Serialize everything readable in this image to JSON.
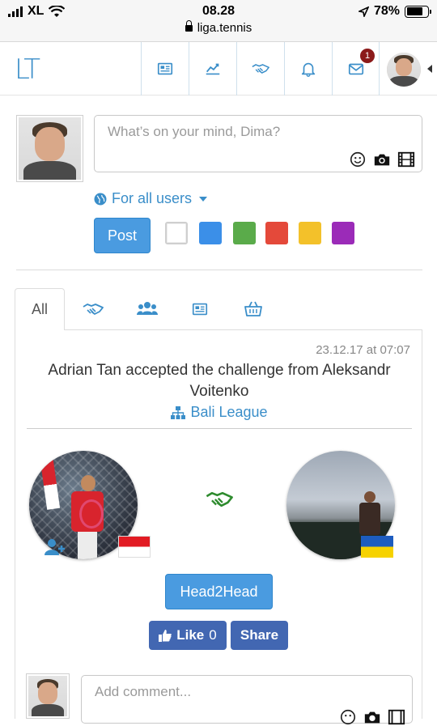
{
  "status_bar": {
    "carrier": "XL",
    "time": "08.28",
    "url": "liga.tennis",
    "battery": "78%",
    "battery_level": 0.78
  },
  "navbar": {
    "logo": "LT",
    "notification_count": "1",
    "icons": [
      "newspaper-icon",
      "chart-line-icon",
      "handshake-icon",
      "bell-icon",
      "envelope-icon"
    ]
  },
  "composer": {
    "placeholder": "What’s on your mind, Dima?",
    "audience": "For all users",
    "post_label": "Post",
    "colors": [
      "#ffffff",
      "#3b8fe8",
      "#5aab4a",
      "#e4493a",
      "#f3c12a",
      "#9b2bb8"
    ]
  },
  "tabs": {
    "active_label": "All",
    "icons": [
      "handshake-icon",
      "users-icon",
      "newspaper-icon",
      "basket-icon"
    ]
  },
  "feed": {
    "timestamp": "23.12.17 at 07:07",
    "headline": "Adrian Tan accepted the challenge from Aleksandr Voitenko",
    "league": "Bali League",
    "h2h_label": "Head2Head",
    "like_label": "Like",
    "like_count": "0",
    "share_label": "Share"
  },
  "comment": {
    "placeholder": "Add comment..."
  },
  "colors": {
    "primary": "#3a8ec9",
    "button": "#4a9be0",
    "facebook": "#4267b2",
    "badge": "#8b1a1a",
    "handshake_green": "#2e8b2e"
  }
}
